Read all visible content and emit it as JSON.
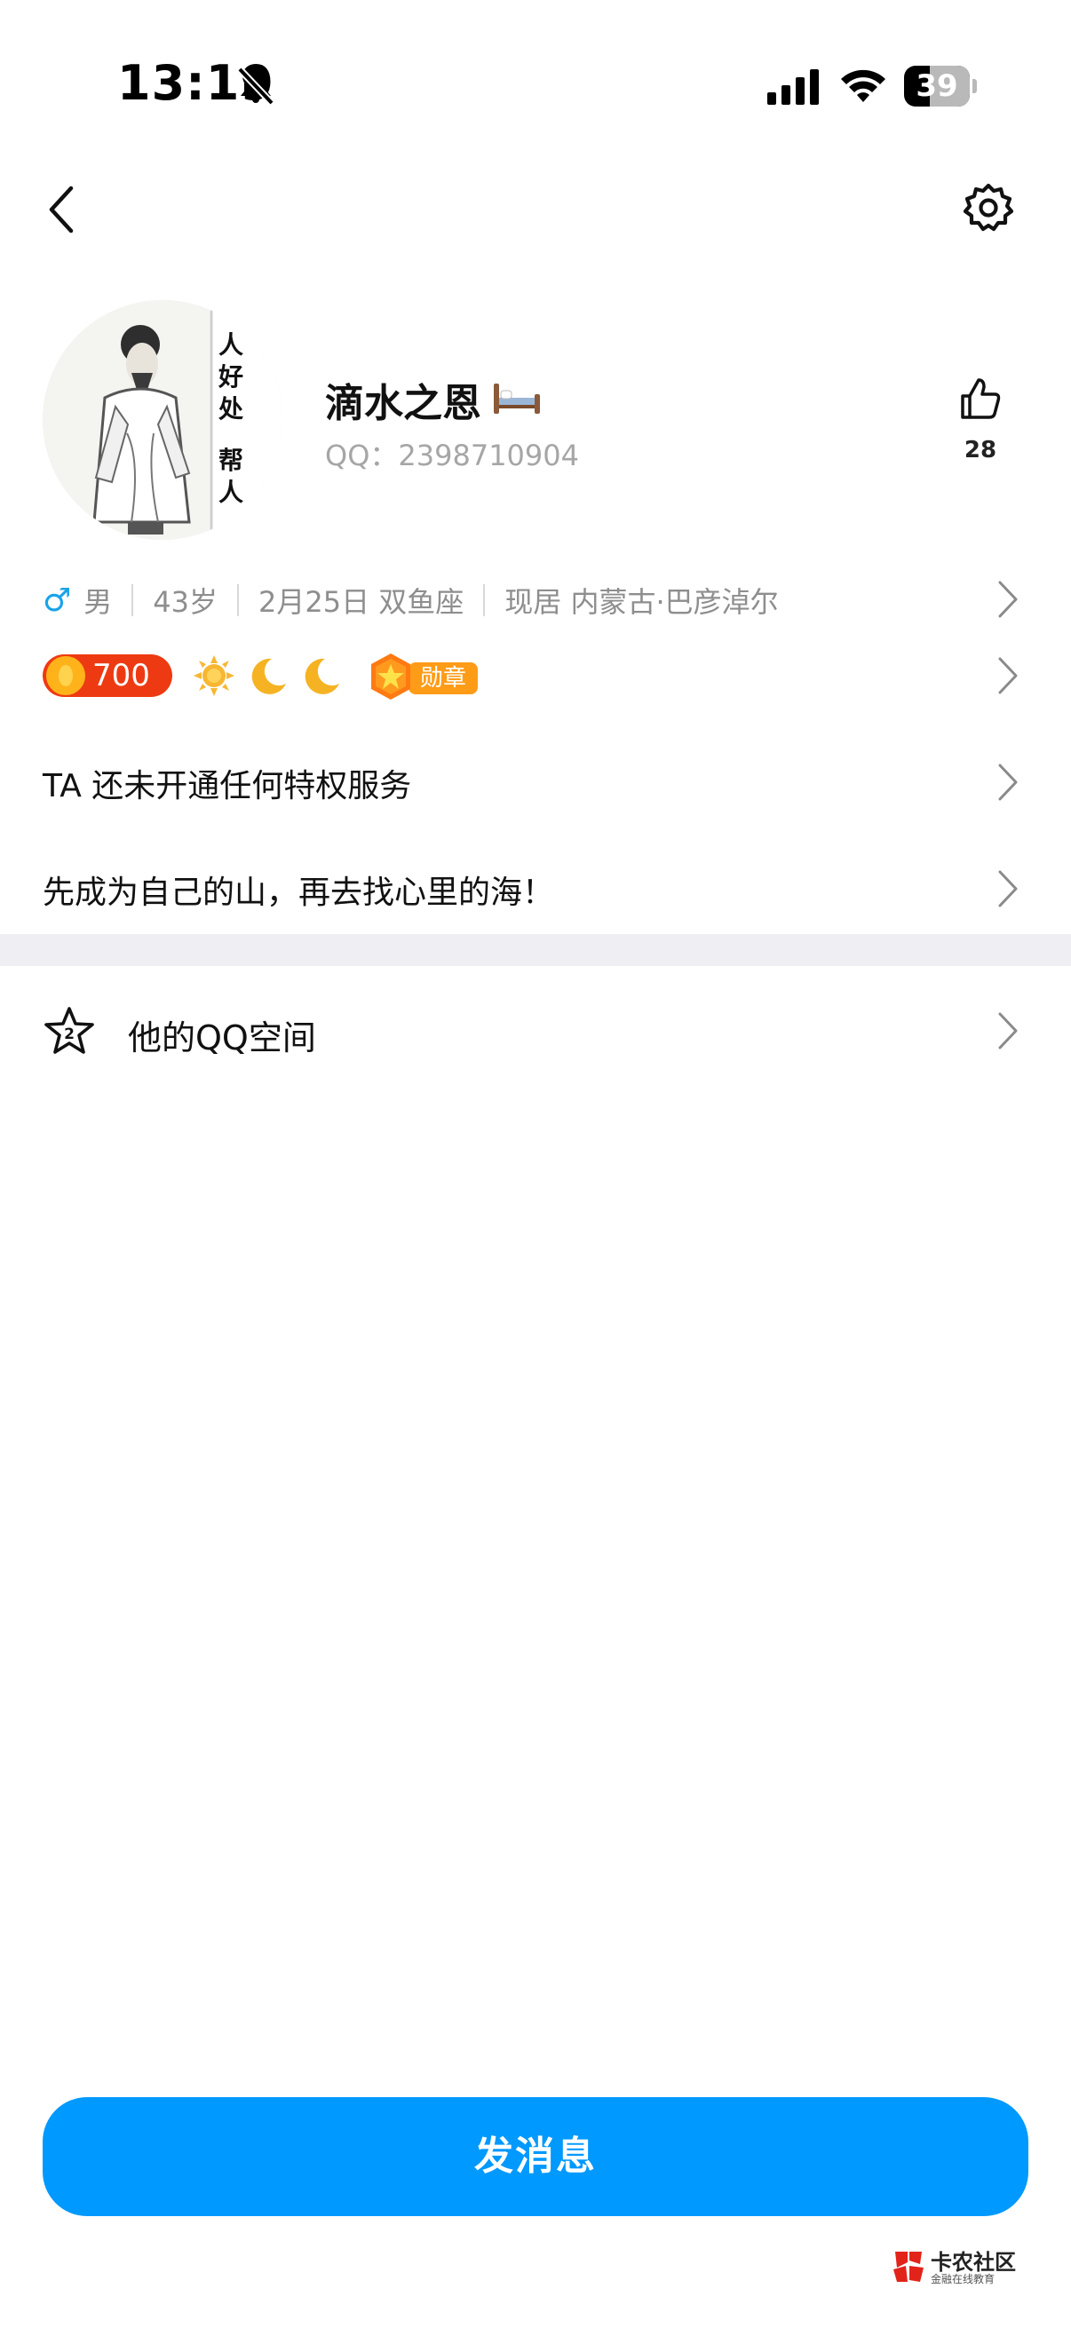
{
  "status_bar": {
    "time": "13:19",
    "battery_level": "39",
    "battery_fraction": 0.39
  },
  "nav": {
    "back_icon": "chevron-left-icon",
    "settings_icon": "gear-icon"
  },
  "profile": {
    "nickname": "滴水之恩",
    "qq_label": "QQ：",
    "qq_number": "2398710904",
    "like_count": "28",
    "avatar_text": "人好处 帮人"
  },
  "info": {
    "gender_symbol": "♂",
    "gender": "男",
    "age": "43岁",
    "birthday": "2月25日 双鱼座",
    "location": "现居 内蒙古·巴彦淖尔"
  },
  "badges": {
    "level_value": "700",
    "medal_label": "勋章"
  },
  "privilege_text": "TA 还未开通任何特权服务",
  "signature": "先成为自己的山，再去找心里的海！",
  "qzone": {
    "label": "他的QQ空间",
    "icon_number": "2"
  },
  "actions": {
    "send_message": "发消息"
  },
  "watermark": {
    "title": "卡农社区",
    "subtitle": "金融在线教育"
  },
  "colors": {
    "primary_button": "#0099ff",
    "male_blue": "#1aa3e8",
    "level_red": "#ee3a12",
    "medal_orange": "#ff9c17",
    "divider_gray": "#efeff3"
  }
}
